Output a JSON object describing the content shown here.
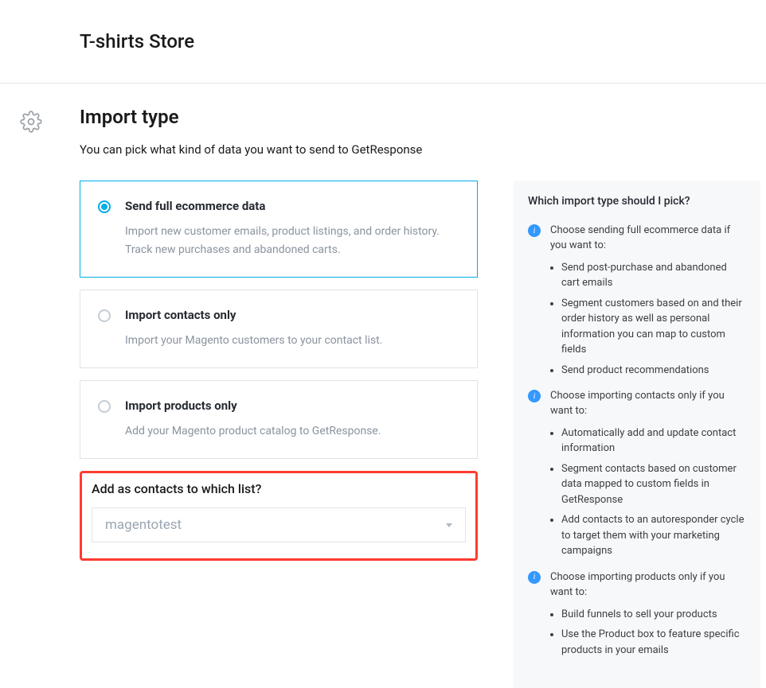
{
  "header": {
    "title": "T-shirts Store"
  },
  "section": {
    "heading": "Import type",
    "subheading": "You can pick what kind of data you want to send to GetResponse"
  },
  "options": [
    {
      "title": "Send full ecommerce data",
      "desc": "Import new customer emails, product listings, and order history. Track new purchases and abandoned carts.",
      "selected": true
    },
    {
      "title": "Import contacts only",
      "desc": "Import your Magento customers to your contact list.",
      "selected": false
    },
    {
      "title": "Import products only",
      "desc": "Add your Magento product catalog to GetResponse.",
      "selected": false
    }
  ],
  "list_field": {
    "label": "Add as contacts to which list?",
    "value": "magentotest"
  },
  "help": {
    "title": "Which import type should I pick?",
    "blocks": [
      {
        "lead": "Choose sending full ecommerce data if you want to:",
        "items": [
          "Send post-purchase and abandoned cart emails",
          "Segment customers based on and their order history as well as personal information you can map to custom fields",
          "Send product recommendations"
        ]
      },
      {
        "lead": "Choose importing contacts only if you want to:",
        "items": [
          "Automatically add and update contact information",
          "Segment contacts based on customer data mapped to custom fields in GetResponse",
          "Add contacts to an autoresponder cycle to target them with your marketing campaigns"
        ]
      },
      {
        "lead": "Choose importing products only if you want to:",
        "items": [
          "Build funnels to sell your products",
          "Use the Product box to feature specific products in your emails"
        ]
      }
    ]
  }
}
